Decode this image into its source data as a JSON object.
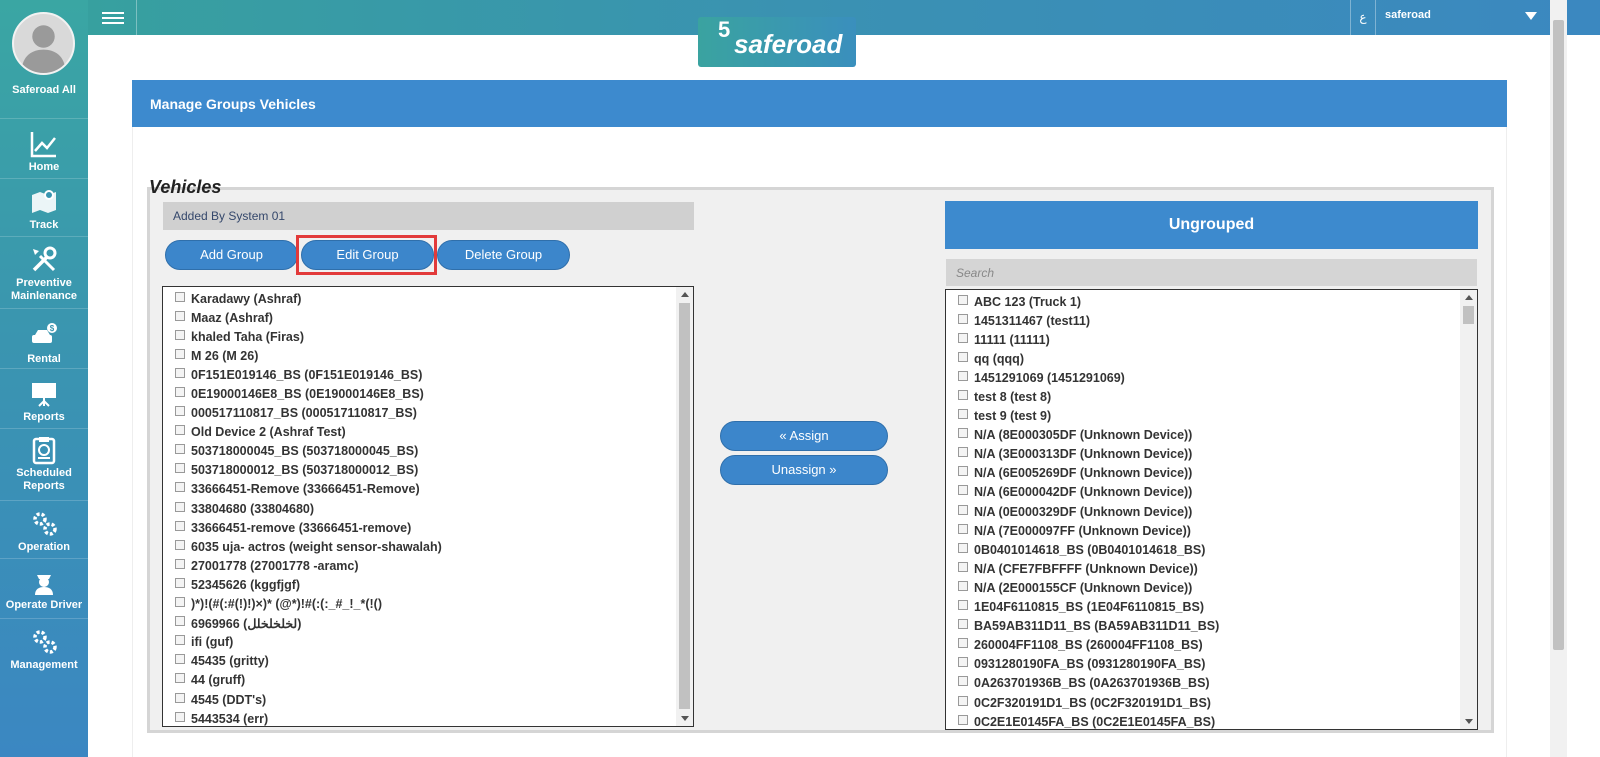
{
  "sidebar": {
    "user_name": "Saferoad All",
    "items": [
      {
        "label": "Home",
        "icon": "chart-icon"
      },
      {
        "label": "Track",
        "icon": "map-icon"
      },
      {
        "label": "Preventive Mainlenance",
        "label_lines": [
          "Preventive",
          "Mainlenance"
        ],
        "icon": "tools-icon"
      },
      {
        "label": "Rental",
        "icon": "car-rental-icon"
      },
      {
        "label": "Reports",
        "icon": "presentation-icon"
      },
      {
        "label": "Scheduled Reports",
        "label_lines": [
          "Scheduled",
          "Reports"
        ],
        "icon": "clipboard-icon"
      },
      {
        "label": "Operation",
        "icon": "gears-icon"
      },
      {
        "label": "Operate Driver",
        "icon": "driver-icon"
      },
      {
        "label": "Management",
        "icon": "gears-icon"
      }
    ]
  },
  "topbar": {
    "language_toggle": "ع",
    "user_name": "saferoad"
  },
  "logo": {
    "mark": "5",
    "word": "saferoad"
  },
  "panel": {
    "title": "Manage Groups Vehicles"
  },
  "vehicles_section": {
    "legend": "Vehicles",
    "selected_group": "Added By System 01",
    "buttons": {
      "add": "Add Group",
      "edit": "Edit Group",
      "delete": "Delete Group"
    },
    "items": [
      "Karadawy (Ashraf)",
      "Maaz (Ashraf)",
      "khaled Taha (Firas)",
      "M 26 (M 26)",
      "0F151E019146_BS (0F151E019146_BS)",
      "0E19000146E8_BS (0E19000146E8_BS)",
      "000517110817_BS (000517110817_BS)",
      "Old Device 2 (Ashraf Test)",
      "503718000045_BS (503718000045_BS)",
      "503718000012_BS (503718000012_BS)",
      "33666451-Remove (33666451-Remove)",
      "33804680 (33804680)",
      "33666451-remove (33666451-remove)",
      "6035 uja- actros (weight sensor-shawalah)",
      "27001778 (27001778 -aramc)",
      "52345626 (kggfjgf)",
      ")*)!(#(:#(!)!)×)* (@*)!#(:(:_#_!_*(!()",
      "6969966 (لخلخلخلل)",
      "ifi (guf)",
      "45435 (gritty)",
      "44 (gruff)",
      "4545 (DDT's)",
      "5443534 (err)"
    ]
  },
  "transfer": {
    "assign": "« Assign",
    "unassign": "Unassign »"
  },
  "ungrouped_section": {
    "title": "Ungrouped",
    "search_placeholder": "Search",
    "items": [
      "ABC 123 (Truck 1)",
      "1451311467 (test11)",
      "11111 (11111)",
      "qq (qqq)",
      "1451291069 (1451291069)",
      "test 8 (test 8)",
      "test 9 (test 9)",
      "N/A (8E000305DF (Unknown Device))",
      "N/A (3E000313DF (Unknown Device))",
      "N/A (6E005269DF (Unknown Device))",
      "N/A (6E000042DF (Unknown Device))",
      "N/A (0E000329DF (Unknown Device))",
      "N/A (7E000097FF (Unknown Device))",
      "0B0401014618_BS (0B0401014618_BS)",
      "N/A (CFE7FBFFFF (Unknown Device))",
      "N/A (2E000155CF (Unknown Device))",
      "1E04F6110815_BS (1E04F6110815_BS)",
      "BA59AB311D11_BS (BA59AB311D11_BS)",
      "260004FF1108_BS (260004FF1108_BS)",
      "0931280190FA_BS (0931280190FA_BS)",
      "0A263701936B_BS (0A263701936B_BS)",
      "0C2F320191D1_BS (0C2F320191D1_BS)",
      "0C2E1E0145FA_BS (0C2E1E0145FA_BS)"
    ]
  },
  "colors": {
    "primary": "#3d8ace",
    "sidebar_top": "#3aa6a3",
    "sidebar_bottom": "#3b87c2",
    "highlight": "#e23a3a"
  }
}
